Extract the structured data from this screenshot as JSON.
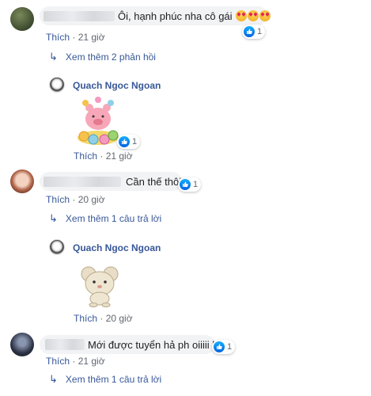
{
  "comments": [
    {
      "text": "Ôi, hạnh phúc nha cô gái",
      "emojis": [
        "heart-eyes-emoji",
        "heart-eyes-emoji",
        "heart-eyes-emoji"
      ],
      "like_label": "Thích",
      "time": "21 giờ",
      "reactions": "1",
      "replies_link": "Xem thêm 2 phản hồi",
      "reply": {
        "author": "Quach Ngoc Ngoan",
        "sticker": "pink-pig-donuts-sticker",
        "like_label": "Thích",
        "time": "21 giờ",
        "reactions": "1"
      }
    },
    {
      "text": "Cần thế thôi",
      "like_label": "Thích",
      "time": "20 giờ",
      "reactions": "1",
      "replies_link": "Xem thêm 1 câu trả lời",
      "reply": {
        "author": "Quach Ngoc Ngoan",
        "sticker": "cartoon-mouse-sticker",
        "like_label": "Thích",
        "time": "20 giờ"
      }
    },
    {
      "text": "Mới được tuyển hả ph oiiiii hiii",
      "like_label": "Thích",
      "time": "21 giờ",
      "reactions": "1",
      "replies_link": "Xem thêm 1 câu trả lời"
    }
  ],
  "separator": "·",
  "colors": {
    "link": "#385898",
    "bubble": "#f2f3f5",
    "like_blue": "#1877f2"
  }
}
